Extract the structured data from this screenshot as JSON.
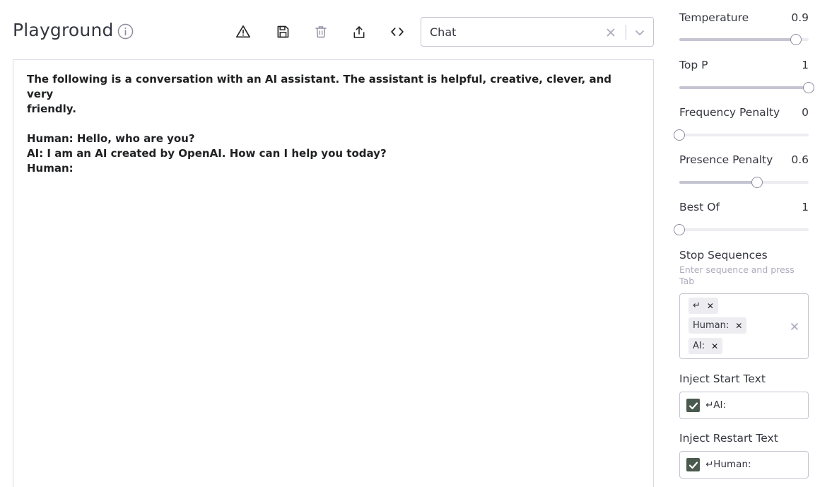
{
  "header": {
    "title": "Playground",
    "toolbar": [
      {
        "icon": "warning-icon"
      },
      {
        "icon": "save-icon"
      },
      {
        "icon": "trash-icon"
      },
      {
        "icon": "share-icon"
      },
      {
        "icon": "code-icon"
      }
    ],
    "preset": {
      "value": "Chat"
    }
  },
  "editor": {
    "lines": [
      "The following is a conversation with an AI assistant. The assistant is helpful, creative, clever, and very",
      "friendly.",
      "",
      "Human: Hello, who are you?",
      "AI: I am an AI created by OpenAI. How can I help you today?",
      "Human:"
    ]
  },
  "settings": {
    "temperature": {
      "label": "Temperature",
      "value": "0.9",
      "fraction": 0.9
    },
    "top_p": {
      "label": "Top P",
      "value": "1",
      "fraction": 1.0
    },
    "frequency_penalty": {
      "label": "Frequency Penalty",
      "value": "0",
      "fraction": 0.0
    },
    "presence_penalty": {
      "label": "Presence Penalty",
      "value": "0.6",
      "fraction": 0.6
    },
    "best_of": {
      "label": "Best Of",
      "value": "1",
      "fraction": 0.0
    },
    "stop_sequences": {
      "label": "Stop Sequences",
      "hint": "Enter sequence and press Tab",
      "chips": [
        "↵",
        "Human:",
        "AI:"
      ]
    },
    "inject_start": {
      "label": "Inject Start Text",
      "checked": true,
      "value": "↵AI:"
    },
    "inject_restart": {
      "label": "Inject Restart Text",
      "checked": true,
      "value": "↵Human:"
    }
  },
  "colors": {
    "accent": "#4b5a4e",
    "border": "#c5c5d2",
    "text": "#353740"
  }
}
